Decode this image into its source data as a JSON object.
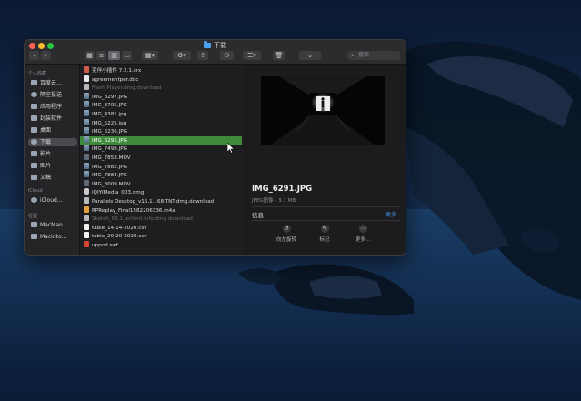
{
  "window": {
    "title": "下载",
    "search_placeholder": "搜索"
  },
  "toolbar": {
    "back_icon": "chevron-left-icon",
    "forward_icon": "chevron-right-icon",
    "view_icons": "grid-icon",
    "view_list": "list-icon",
    "view_columns": "columns-icon",
    "view_gallery": "gallery-icon",
    "group_icon": "group-icon",
    "action_icon": "gear-icon",
    "share_icon": "share-icon",
    "tag_icon": "tag-icon",
    "sort_icon": "sort-icon",
    "delete_icon": "trash-icon",
    "dropdown_icon": "chevron-down-icon",
    "search_icon": "search-icon"
  },
  "sidebar": {
    "favorites_header": "个人收藏",
    "favorites": [
      {
        "label": "百度云…",
        "icon": "cloud-icon"
      },
      {
        "label": "隔空投送",
        "icon": "airdrop-icon"
      },
      {
        "label": "应用程序",
        "icon": "applications-icon"
      },
      {
        "label": "封装软件",
        "icon": "folder-icon"
      },
      {
        "label": "桌面",
        "icon": "desktop-icon"
      },
      {
        "label": "下载",
        "icon": "downloads-icon",
        "selected": true
      },
      {
        "label": "影片",
        "icon": "movies-icon"
      },
      {
        "label": "图片",
        "icon": "pictures-icon"
      },
      {
        "label": "文稿",
        "icon": "documents-icon"
      }
    ],
    "icloud_header": "iCloud",
    "icloud": [
      {
        "label": "iCloud…",
        "icon": "icloud-icon"
      }
    ],
    "locations_header": "位置",
    "locations": [
      {
        "label": "MacMan",
        "icon": "computer-icon"
      },
      {
        "label": "Macinto…",
        "icon": "disk-icon"
      }
    ]
  },
  "files": [
    {
      "name": "变伴小插件 7.2.1.crx",
      "type": "crx",
      "dim": false
    },
    {
      "name": "agreementper.doc",
      "type": "doc",
      "dim": false
    },
    {
      "name": "Flash Player.dmg.download",
      "type": "pkg",
      "dim": true
    },
    {
      "name": "IMG_3297.JPG",
      "type": "img",
      "dim": false
    },
    {
      "name": "IMG_3705.JPG",
      "type": "img",
      "dim": false
    },
    {
      "name": "IMG_4381.jpg",
      "type": "img",
      "dim": false
    },
    {
      "name": "IMG_5225.jpg",
      "type": "img",
      "dim": false
    },
    {
      "name": "IMG_6236.JPG",
      "type": "img",
      "dim": false
    },
    {
      "name": "IMG_6291.JPG",
      "type": "img",
      "dim": false,
      "selected": true
    },
    {
      "name": "IMG_7498.JPG",
      "type": "img",
      "dim": false
    },
    {
      "name": "IMG_7853.MOV",
      "type": "mov",
      "dim": false
    },
    {
      "name": "IMG_7882.JPG",
      "type": "img",
      "dim": false
    },
    {
      "name": "IMG_7884.JPG",
      "type": "img",
      "dim": false
    },
    {
      "name": "IMG_8009.MOV",
      "type": "mov",
      "dim": false
    },
    {
      "name": "iQIYIMedia_003.dmg",
      "type": "dmg",
      "dim": false
    },
    {
      "name": "Parallels Desktop_v15.1...68-TNT.dmg.download",
      "type": "pkg",
      "dim": false
    },
    {
      "name": "RPReplay_Final1582206336.m4a",
      "type": "m4a",
      "dim": false
    },
    {
      "name": "Sketch_63.1_xclient.info.dmg.download",
      "type": "pkg",
      "dim": true
    },
    {
      "name": "table_14-14-2020.csv",
      "type": "csv",
      "dim": false
    },
    {
      "name": "table_20-20-2020.csv",
      "type": "csv",
      "dim": false
    },
    {
      "name": "uppod.swf",
      "type": "swf",
      "dim": false
    }
  ],
  "preview": {
    "name": "IMG_6291.JPG",
    "kind": "JPEG图像 - 3.1 MB",
    "info_label": "信息",
    "more_label": "更多",
    "actions": [
      {
        "label": "向左旋转",
        "icon": "rotate-left-icon"
      },
      {
        "label": "标记",
        "icon": "markup-icon"
      },
      {
        "label": "更多…",
        "icon": "more-icon"
      }
    ]
  },
  "colors": {
    "selection": "#3f8a3b",
    "accent": "#3d8fe6"
  }
}
